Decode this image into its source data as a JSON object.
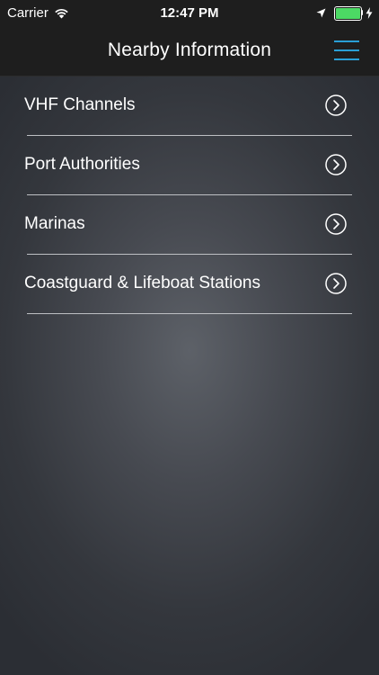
{
  "status_bar": {
    "carrier": "Carrier",
    "time": "12:47 PM",
    "battery_level": 1.0,
    "icons": [
      "wifi-icon",
      "location-arrow-icon",
      "battery-icon",
      "charging-bolt-icon"
    ]
  },
  "nav": {
    "title": "Nearby Information",
    "menu_icon": "hamburger-menu-icon",
    "accent_color": "#2a9fd6"
  },
  "list": {
    "items": [
      {
        "label": "VHF Channels",
        "icon": "chevron-right-circle-icon"
      },
      {
        "label": "Port Authorities",
        "icon": "chevron-right-circle-icon"
      },
      {
        "label": "Marinas",
        "icon": "chevron-right-circle-icon"
      },
      {
        "label": "Coastguard & Lifeboat Stations",
        "icon": "chevron-right-circle-icon"
      }
    ]
  }
}
